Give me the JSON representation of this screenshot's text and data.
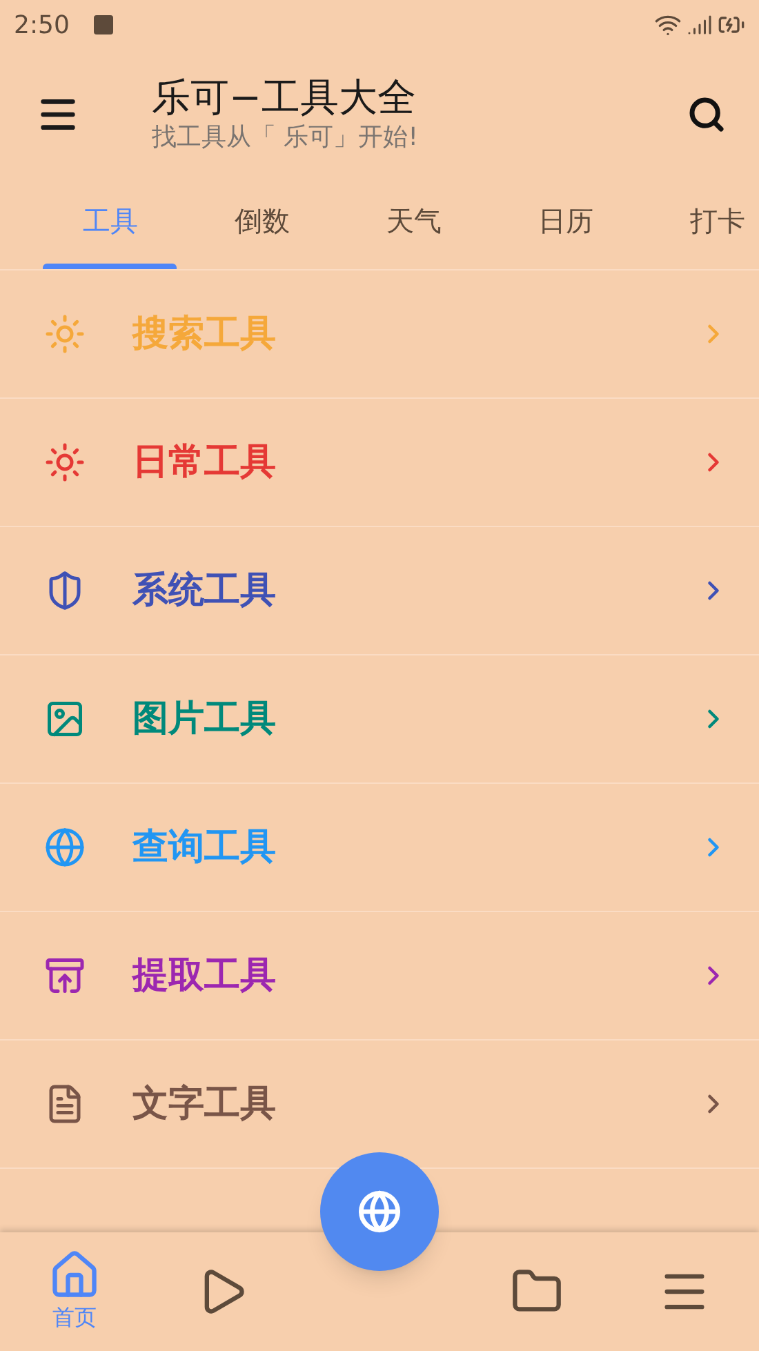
{
  "status_bar": {
    "time": "2:50"
  },
  "app_bar": {
    "title": "乐可−工具大全",
    "subtitle": "找工具从「 乐可」开始!"
  },
  "tabs": [
    {
      "label": "工具",
      "selected": true
    },
    {
      "label": "倒数",
      "selected": false
    },
    {
      "label": "天气",
      "selected": false
    },
    {
      "label": "日历",
      "selected": false
    },
    {
      "label": "打卡",
      "selected": false
    }
  ],
  "items": [
    {
      "label": "搜索工具",
      "color": "#f5a83a"
    },
    {
      "label": "日常工具",
      "color": "#e53935"
    },
    {
      "label": "系统工具",
      "color": "#3f51b5"
    },
    {
      "label": "图片工具",
      "color": "#00897b"
    },
    {
      "label": "查询工具",
      "color": "#2196f3"
    },
    {
      "label": "提取工具",
      "color": "#9c27b0"
    },
    {
      "label": "文字工具",
      "color": "#795548"
    }
  ],
  "bottom_nav": [
    {
      "label": "首页",
      "selected": true
    },
    {
      "selected": false
    },
    {
      "selected": false
    },
    {
      "selected": false
    }
  ]
}
